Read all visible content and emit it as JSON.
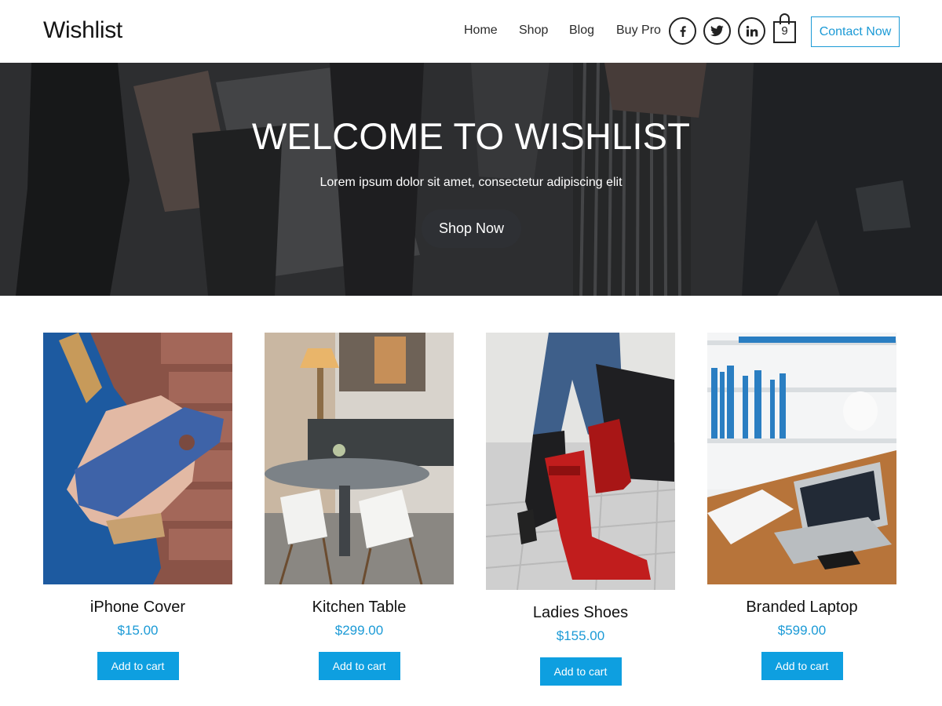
{
  "header": {
    "site_title": "Wishlist",
    "nav": [
      "Home",
      "Shop",
      "Blog",
      "Buy Pro"
    ],
    "social": [
      "facebook-icon",
      "twitter-icon",
      "linkedin-icon"
    ],
    "cart_count": "9",
    "contact_label": "Contact Now"
  },
  "hero": {
    "title": "WELCOME TO WISHLIST",
    "subtitle": "Lorem ipsum dolor sit amet, consectetur adipiscing elit",
    "button_label": "Shop Now"
  },
  "products": [
    {
      "name": "iPhone Cover",
      "price": "$15.00",
      "button": "Add to cart"
    },
    {
      "name": "Kitchen Table",
      "price": "$299.00",
      "button": "Add to cart"
    },
    {
      "name": "Ladies Shoes",
      "price": "$155.00",
      "button": "Add to cart"
    },
    {
      "name": "Branded Laptop",
      "price": "$599.00",
      "button": "Add to cart"
    }
  ],
  "colors": {
    "accent": "#1b9ad6",
    "button": "#0e9fe0",
    "hero_overlay": "#3a3b3e"
  }
}
